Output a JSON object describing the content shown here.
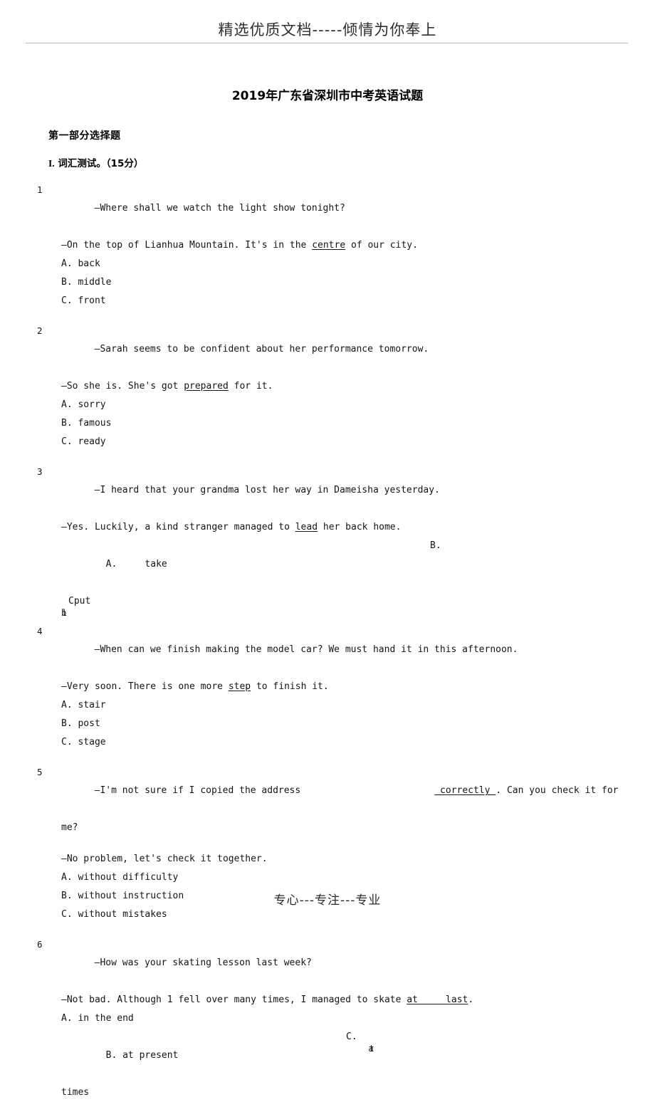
{
  "header": {
    "banner_text": "精选优质文档-----倾情为你奉上"
  },
  "title": "2019年广东省深圳市中考英语试题",
  "part_heading": "第一部分选择题",
  "section": {
    "number": "I.",
    "label": "词汇测试。（15分）"
  },
  "questions": [
    {
      "num": "1",
      "line1": "—Where shall we watch the light show tonight?",
      "line2_pre": "—On the top of Lianhua Mountain. It's in the ",
      "line2_underline": "centre",
      "line2_post": " of our city.",
      "options": [
        "A. back",
        "B. middle",
        "C. front"
      ]
    },
    {
      "num": "2",
      "line1": "—Sarah seems to be confident about her performance tomorrow.",
      "line2_pre": "—So she is. She's got ",
      "line2_underline": "prepared",
      "line2_post": " for it.",
      "options": [
        "A. sorry",
        "B. famous",
        "C. ready"
      ]
    },
    {
      "num": "3",
      "line1": "—I heard that your grandma lost her way in Dameisha yesterday.",
      "line2_pre": "—Yes. Luckily, a kind stranger managed to ",
      "line2_underline": "lead",
      "line2_post": " her back home.",
      "option_a": "A.     take",
      "option_b_right": "B.",
      "option_garbled_glyph1": "b",
      "option_garbled_glyph2": "l",
      "option_c_text": "Cput"
    },
    {
      "num": "4",
      "line1": "—When can we finish making the model car? We must hand it in this afternoon.",
      "line2_pre": "—Very soon. There is one more ",
      "line2_underline": "step",
      "line2_post": " to finish it.",
      "options": [
        "A. stair",
        "B. post",
        "C. stage"
      ]
    },
    {
      "num": "5",
      "line1_pre": "—I'm not sure if I copied the address",
      "line1_underline": " correctly ",
      "line1_post": ". Can you check it for",
      "line1_wrap": "me?",
      "line2": "—No problem, let's check it together.",
      "options": [
        "A. without difficulty",
        "B. without instruction",
        "C. without mistakes"
      ]
    },
    {
      "num": "6",
      "line1": "—How was your skating lesson last week?",
      "line2_pre": "—Not bad. Although 1 fell over many times, I managed to skate ",
      "line2_underline": "at     last",
      "line2_post": ".",
      "option_a": "A. in the end",
      "option_b": "B. at present",
      "option_c_right": "C.",
      "option_c_glyph1": "a",
      "option_c_glyph2": "t",
      "option_c_wrap": "times"
    }
  ],
  "footer": {
    "text": "专心---专注---专业"
  }
}
